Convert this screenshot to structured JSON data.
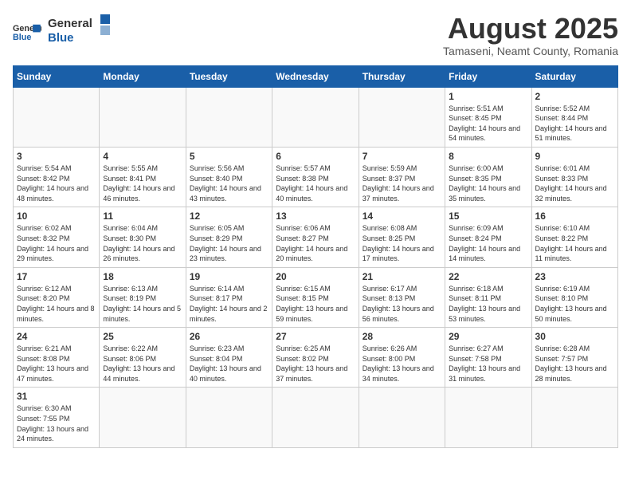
{
  "header": {
    "logo_general": "General",
    "logo_blue": "Blue",
    "month_year": "August 2025",
    "location": "Tamaseni, Neamt County, Romania"
  },
  "weekdays": [
    "Sunday",
    "Monday",
    "Tuesday",
    "Wednesday",
    "Thursday",
    "Friday",
    "Saturday"
  ],
  "weeks": [
    [
      {
        "day": "",
        "info": ""
      },
      {
        "day": "",
        "info": ""
      },
      {
        "day": "",
        "info": ""
      },
      {
        "day": "",
        "info": ""
      },
      {
        "day": "",
        "info": ""
      },
      {
        "day": "1",
        "info": "Sunrise: 5:51 AM\nSunset: 8:45 PM\nDaylight: 14 hours and 54 minutes."
      },
      {
        "day": "2",
        "info": "Sunrise: 5:52 AM\nSunset: 8:44 PM\nDaylight: 14 hours and 51 minutes."
      }
    ],
    [
      {
        "day": "3",
        "info": "Sunrise: 5:54 AM\nSunset: 8:42 PM\nDaylight: 14 hours and 48 minutes."
      },
      {
        "day": "4",
        "info": "Sunrise: 5:55 AM\nSunset: 8:41 PM\nDaylight: 14 hours and 46 minutes."
      },
      {
        "day": "5",
        "info": "Sunrise: 5:56 AM\nSunset: 8:40 PM\nDaylight: 14 hours and 43 minutes."
      },
      {
        "day": "6",
        "info": "Sunrise: 5:57 AM\nSunset: 8:38 PM\nDaylight: 14 hours and 40 minutes."
      },
      {
        "day": "7",
        "info": "Sunrise: 5:59 AM\nSunset: 8:37 PM\nDaylight: 14 hours and 37 minutes."
      },
      {
        "day": "8",
        "info": "Sunrise: 6:00 AM\nSunset: 8:35 PM\nDaylight: 14 hours and 35 minutes."
      },
      {
        "day": "9",
        "info": "Sunrise: 6:01 AM\nSunset: 8:33 PM\nDaylight: 14 hours and 32 minutes."
      }
    ],
    [
      {
        "day": "10",
        "info": "Sunrise: 6:02 AM\nSunset: 8:32 PM\nDaylight: 14 hours and 29 minutes."
      },
      {
        "day": "11",
        "info": "Sunrise: 6:04 AM\nSunset: 8:30 PM\nDaylight: 14 hours and 26 minutes."
      },
      {
        "day": "12",
        "info": "Sunrise: 6:05 AM\nSunset: 8:29 PM\nDaylight: 14 hours and 23 minutes."
      },
      {
        "day": "13",
        "info": "Sunrise: 6:06 AM\nSunset: 8:27 PM\nDaylight: 14 hours and 20 minutes."
      },
      {
        "day": "14",
        "info": "Sunrise: 6:08 AM\nSunset: 8:25 PM\nDaylight: 14 hours and 17 minutes."
      },
      {
        "day": "15",
        "info": "Sunrise: 6:09 AM\nSunset: 8:24 PM\nDaylight: 14 hours and 14 minutes."
      },
      {
        "day": "16",
        "info": "Sunrise: 6:10 AM\nSunset: 8:22 PM\nDaylight: 14 hours and 11 minutes."
      }
    ],
    [
      {
        "day": "17",
        "info": "Sunrise: 6:12 AM\nSunset: 8:20 PM\nDaylight: 14 hours and 8 minutes."
      },
      {
        "day": "18",
        "info": "Sunrise: 6:13 AM\nSunset: 8:19 PM\nDaylight: 14 hours and 5 minutes."
      },
      {
        "day": "19",
        "info": "Sunrise: 6:14 AM\nSunset: 8:17 PM\nDaylight: 14 hours and 2 minutes."
      },
      {
        "day": "20",
        "info": "Sunrise: 6:15 AM\nSunset: 8:15 PM\nDaylight: 13 hours and 59 minutes."
      },
      {
        "day": "21",
        "info": "Sunrise: 6:17 AM\nSunset: 8:13 PM\nDaylight: 13 hours and 56 minutes."
      },
      {
        "day": "22",
        "info": "Sunrise: 6:18 AM\nSunset: 8:11 PM\nDaylight: 13 hours and 53 minutes."
      },
      {
        "day": "23",
        "info": "Sunrise: 6:19 AM\nSunset: 8:10 PM\nDaylight: 13 hours and 50 minutes."
      }
    ],
    [
      {
        "day": "24",
        "info": "Sunrise: 6:21 AM\nSunset: 8:08 PM\nDaylight: 13 hours and 47 minutes."
      },
      {
        "day": "25",
        "info": "Sunrise: 6:22 AM\nSunset: 8:06 PM\nDaylight: 13 hours and 44 minutes."
      },
      {
        "day": "26",
        "info": "Sunrise: 6:23 AM\nSunset: 8:04 PM\nDaylight: 13 hours and 40 minutes."
      },
      {
        "day": "27",
        "info": "Sunrise: 6:25 AM\nSunset: 8:02 PM\nDaylight: 13 hours and 37 minutes."
      },
      {
        "day": "28",
        "info": "Sunrise: 6:26 AM\nSunset: 8:00 PM\nDaylight: 13 hours and 34 minutes."
      },
      {
        "day": "29",
        "info": "Sunrise: 6:27 AM\nSunset: 7:58 PM\nDaylight: 13 hours and 31 minutes."
      },
      {
        "day": "30",
        "info": "Sunrise: 6:28 AM\nSunset: 7:57 PM\nDaylight: 13 hours and 28 minutes."
      }
    ],
    [
      {
        "day": "31",
        "info": "Sunrise: 6:30 AM\nSunset: 7:55 PM\nDaylight: 13 hours and 24 minutes."
      },
      {
        "day": "",
        "info": ""
      },
      {
        "day": "",
        "info": ""
      },
      {
        "day": "",
        "info": ""
      },
      {
        "day": "",
        "info": ""
      },
      {
        "day": "",
        "info": ""
      },
      {
        "day": "",
        "info": ""
      }
    ]
  ]
}
